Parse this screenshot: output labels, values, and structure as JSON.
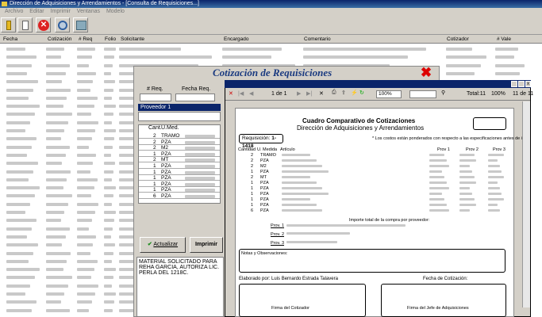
{
  "window": {
    "title": "Dirección de Adquisiciones y Arrendamientos - [Consulta de Requisiciones...]"
  },
  "menu": [
    "Archivo",
    "Editar",
    "Imprimir",
    "Ventanas",
    "Modelo"
  ],
  "grid": {
    "headers": [
      "Fecha",
      "Cotización",
      "# Req",
      "Folio",
      "Solicitante",
      "Encargado",
      "Comentario",
      "Cotizador",
      "# Vale"
    ]
  },
  "cotizacion": {
    "title": "Cotización de Requisiciones",
    "col_req": "# Req.",
    "col_fecha": "Fecha Req.",
    "proveedor_label": "Proveedor 1",
    "items_headers": [
      "Cant.",
      "U.Med."
    ],
    "items": [
      {
        "cant": "2",
        "um": "TRAMO"
      },
      {
        "cant": "2",
        "um": "PZA"
      },
      {
        "cant": "2",
        "um": "M2"
      },
      {
        "cant": "1",
        "um": "PZA"
      },
      {
        "cant": "2",
        "um": "MT"
      },
      {
        "cant": "1",
        "um": "PZA"
      },
      {
        "cant": "1",
        "um": "PZA"
      },
      {
        "cant": "1",
        "um": "PZA"
      },
      {
        "cant": "1",
        "um": "PZA"
      },
      {
        "cant": "1",
        "um": "PZA"
      },
      {
        "cant": "6",
        "um": "PZA"
      }
    ],
    "btn_actualizar": "Actualizar",
    "btn_imprimir": "Imprimir",
    "nota": "MATERIAL SOLICITADO PARA REHA GARCIA, AUTORIZA LIC. PERLA DEL 1218C."
  },
  "report": {
    "page": "1 de 1",
    "zoom": "100%",
    "total": "Total:11",
    "pct": "100%",
    "of": "11 de 11",
    "paper_title": "Cuadro Comparativo de Cotizaciones",
    "paper_sub": "Dirección de Adquisiciones y Arrendamientos",
    "note": "* Los costos están ponderados con respecto a las especificaciones antes de iva",
    "req_label": "Requisición:",
    "req_value": "1-1418",
    "col_headers": [
      "Cantidad",
      "U. Medida",
      "Artículo",
      "Prov 1",
      "Prov 2",
      "Prov 3"
    ],
    "rows": [
      {
        "cant": "2",
        "um": "TRAMO"
      },
      {
        "cant": "2",
        "um": "PZA"
      },
      {
        "cant": "2",
        "um": "M2"
      },
      {
        "cant": "1",
        "um": "PZA"
      },
      {
        "cant": "2",
        "um": "MT"
      },
      {
        "cant": "1",
        "um": "PZA"
      },
      {
        "cant": "1",
        "um": "PZA"
      },
      {
        "cant": "1",
        "um": "PZA"
      },
      {
        "cant": "1",
        "um": "PZA"
      },
      {
        "cant": "1",
        "um": "PZA"
      },
      {
        "cant": "6",
        "um": "PZA"
      }
    ],
    "importe": "Importe total de la compra por proveedor:",
    "prov": [
      "Prov. 1",
      "Prov. 2",
      "Prov. 3"
    ],
    "obs": "Notas y Observaciones:",
    "elaborado": "Elaborado por:  Luis Bernardo Estrada Talavera",
    "fecha_cot": "Fecha de Cotización:",
    "firma1": "Firma del Cotizador",
    "firma2": "Firma del Jefe de Adquisiciones"
  }
}
